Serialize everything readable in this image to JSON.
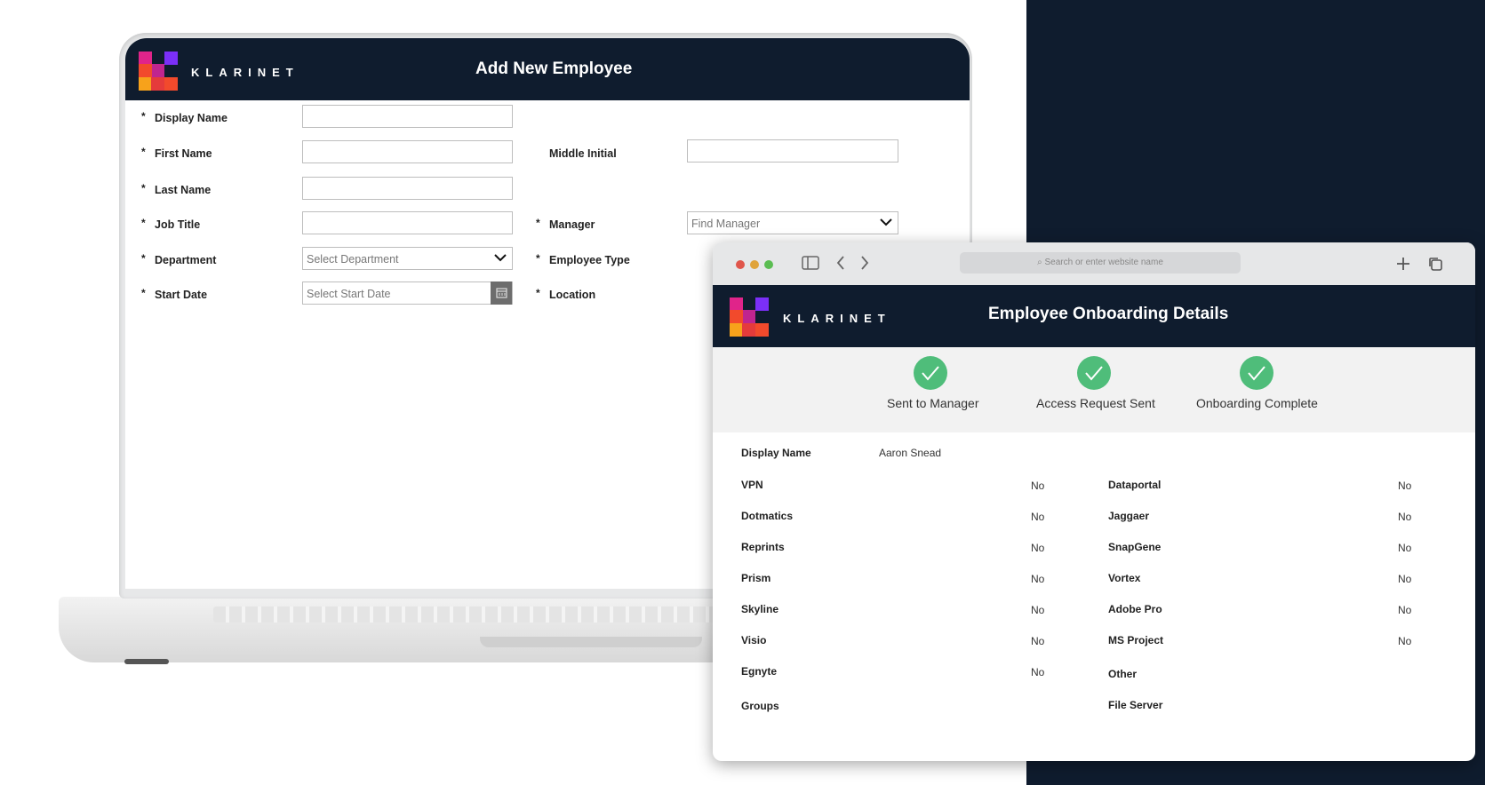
{
  "laptop_app": {
    "brand": "KLARINET",
    "title": "Add New Employee",
    "form": {
      "display_name": {
        "label": "Display Name",
        "value": ""
      },
      "first_name": {
        "label": "First Name",
        "value": ""
      },
      "middle_initial": {
        "label": "Middle Initial",
        "value": ""
      },
      "last_name": {
        "label": "Last Name",
        "value": ""
      },
      "job_title": {
        "label": "Job Title",
        "value": ""
      },
      "manager": {
        "label": "Manager",
        "placeholder": "Find Manager"
      },
      "department": {
        "label": "Department",
        "placeholder": "Select Department"
      },
      "employee_type": {
        "label": "Employee Type"
      },
      "start_date": {
        "label": "Start Date",
        "placeholder": "Select Start Date"
      },
      "location": {
        "label": "Location"
      }
    },
    "required_marker": "*"
  },
  "browser": {
    "url_placeholder": "Search or enter website name",
    "brand": "KLARINET",
    "title": "Employee Onboarding Details",
    "steps": [
      {
        "label": "Sent to Manager",
        "status": "complete"
      },
      {
        "label": "Access Request Sent",
        "status": "complete"
      },
      {
        "label": "Onboarding Complete",
        "status": "complete"
      }
    ],
    "details": {
      "display_name_label": "Display Name",
      "display_name_value": "Aaron Snead",
      "left": [
        {
          "label": "VPN",
          "value": "No"
        },
        {
          "label": "Dotmatics",
          "value": "No"
        },
        {
          "label": "Reprints",
          "value": "No"
        },
        {
          "label": "Prism",
          "value": "No"
        },
        {
          "label": "Skyline",
          "value": "No"
        },
        {
          "label": "Visio",
          "value": "No"
        },
        {
          "label": "Egnyte",
          "value": "No"
        },
        {
          "label": "Groups",
          "value": ""
        }
      ],
      "right": [
        {
          "label": "Dataportal",
          "value": "No"
        },
        {
          "label": "Jaggaer",
          "value": "No"
        },
        {
          "label": "SnapGene",
          "value": "No"
        },
        {
          "label": "Vortex",
          "value": "No"
        },
        {
          "label": "Adobe Pro",
          "value": "No"
        },
        {
          "label": "MS Project",
          "value": "No"
        },
        {
          "label": "Other",
          "value": ""
        },
        {
          "label": "File Server",
          "value": ""
        }
      ]
    }
  },
  "colors": {
    "navy": "#0f1c2e",
    "success": "#4fbd7a",
    "logo": [
      "#7b2ff7",
      "#e0248a",
      "#f24a2c",
      "#f7a21b"
    ]
  }
}
